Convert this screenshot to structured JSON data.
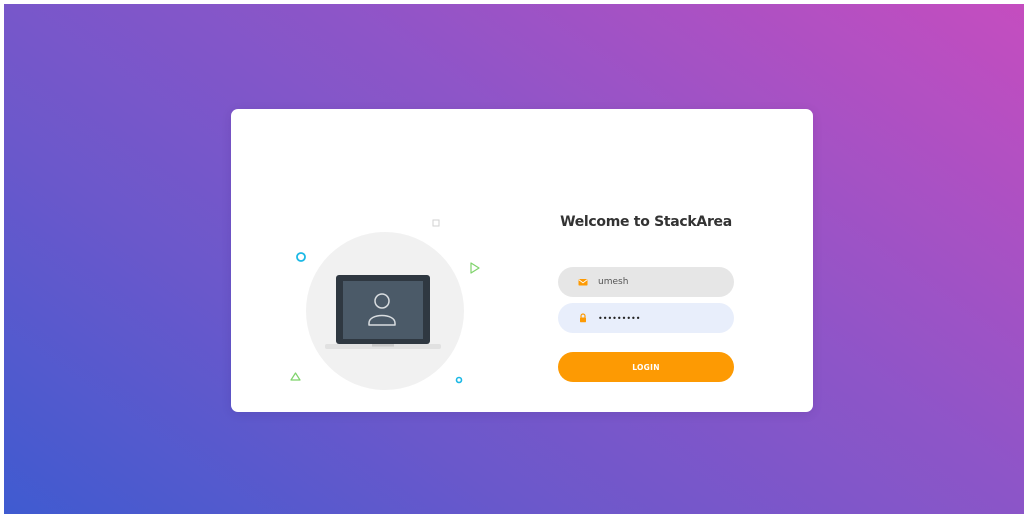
{
  "colors": {
    "gradient_start": "#3f5bd0",
    "gradient_end": "#c54dbf",
    "card": "#ffffff",
    "accent": "#fd9a03",
    "email_field_bg": "#e6e6e6",
    "password_field_bg": "#e8eefb",
    "decor_cyan": "#1bb8e5",
    "decor_green": "#7ed36b"
  },
  "illustration": {
    "icons": [
      "laptop-icon",
      "user-icon",
      "circle-icon",
      "triangle-icon",
      "play-triangle-icon",
      "square-icon"
    ]
  },
  "login": {
    "title": "Welcome to StackArea",
    "email": {
      "icon": "envelope-icon",
      "value": "umesh"
    },
    "password": {
      "icon": "lock-icon",
      "value": "password1"
    },
    "button_label": "LOGIN"
  }
}
